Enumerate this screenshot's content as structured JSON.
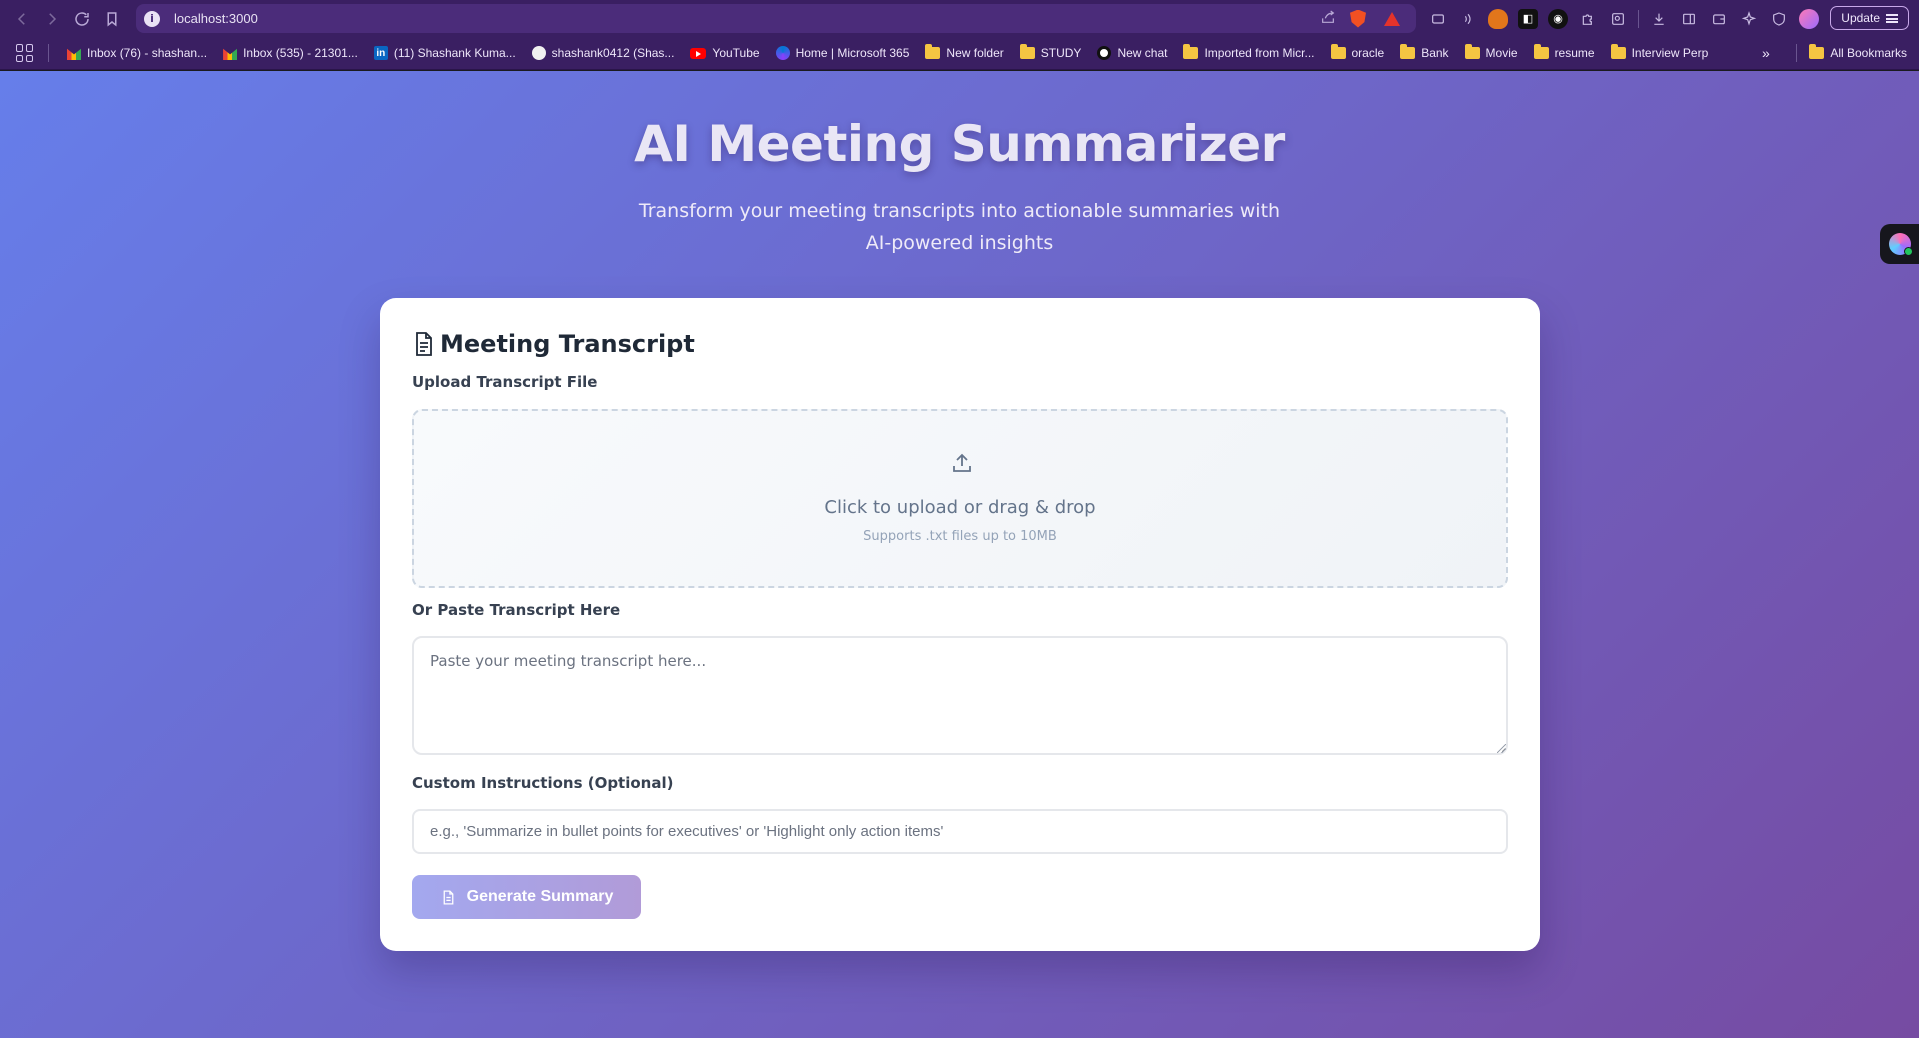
{
  "browser": {
    "url": "localhost:3000",
    "update_label": "Update",
    "bookmarks": [
      {
        "label": "Inbox (76) - shashan...",
        "icon": "gmail-icon"
      },
      {
        "label": "Inbox (535) - 21301...",
        "icon": "gmail-icon"
      },
      {
        "label": "(11) Shashank Kuma...",
        "icon": "linkedin-icon"
      },
      {
        "label": "shashank0412 (Shas...",
        "icon": "github-icon"
      },
      {
        "label": "YouTube",
        "icon": "youtube-icon"
      },
      {
        "label": "Home | Microsoft 365",
        "icon": "microsoft-icon"
      },
      {
        "label": "New folder",
        "icon": "folder-icon"
      },
      {
        "label": "STUDY",
        "icon": "folder-icon"
      },
      {
        "label": "New chat",
        "icon": "openai-icon"
      },
      {
        "label": "Imported from Micr...",
        "icon": "folder-icon"
      },
      {
        "label": "oracle",
        "icon": "folder-icon"
      },
      {
        "label": "Bank",
        "icon": "folder-icon"
      },
      {
        "label": "Movie",
        "icon": "folder-icon"
      },
      {
        "label": "resume",
        "icon": "folder-icon"
      },
      {
        "label": "Interview Perp",
        "icon": "folder-icon"
      }
    ],
    "overflow_label": "»",
    "all_bookmarks_label": "All Bookmarks"
  },
  "hero": {
    "title": "AI Meeting Summarizer",
    "subtitle_line1": "Transform your meeting transcripts into actionable summaries with",
    "subtitle_line2": "AI-powered insights"
  },
  "card": {
    "title": "Meeting Transcript",
    "upload_label": "Upload Transcript File",
    "dropzone_text": "Click to upload or drag & drop",
    "dropzone_hint": "Supports .txt files up to 10MB",
    "paste_label": "Or Paste Transcript Here",
    "paste_placeholder": "Paste your meeting transcript here...",
    "paste_value": "",
    "instructions_label": "Custom Instructions (Optional)",
    "instructions_placeholder": "e.g., 'Summarize in bullet points for executives' or 'Highlight only action items'",
    "instructions_value": "",
    "generate_label": "Generate Summary"
  },
  "colors": {
    "gradient_start": "#667eea",
    "gradient_end": "#764ba2",
    "browser_chrome": "#3a1f62",
    "button_disabled": "#a3a8ef"
  }
}
